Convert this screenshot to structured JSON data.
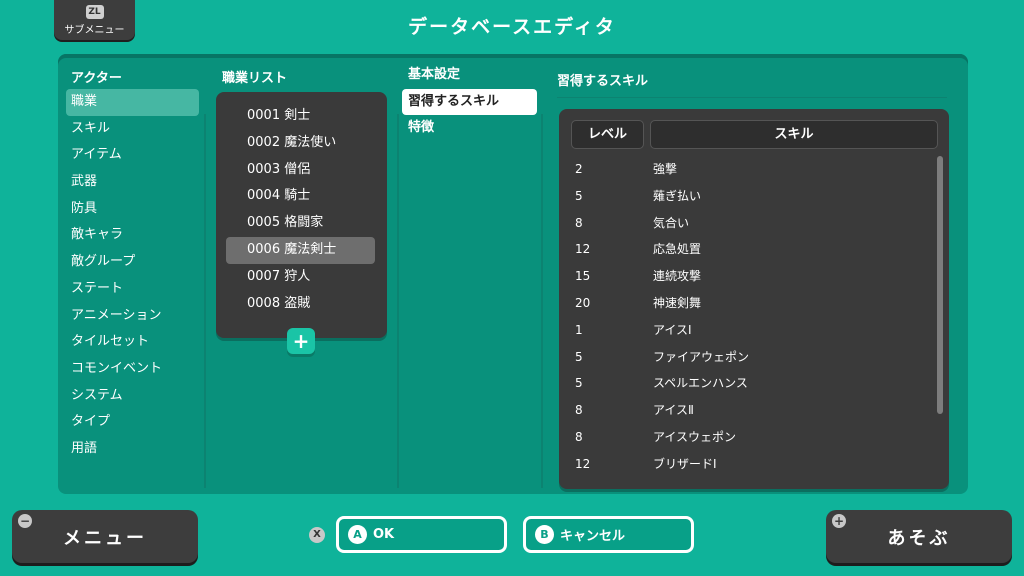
{
  "header": {
    "submenu_badge": "ZL",
    "submenu_label": "サブメニュー",
    "title": "データベースエディタ"
  },
  "categories": {
    "title": "アクター",
    "items": [
      "職業",
      "スキル",
      "アイテム",
      "武器",
      "防具",
      "敵キャラ",
      "敵グループ",
      "ステート",
      "アニメーション",
      "タイルセット",
      "コモンイベント",
      "システム",
      "タイプ",
      "用語"
    ],
    "active_index": 0
  },
  "classes": {
    "title": "職業リスト",
    "items": [
      "0001 剣士",
      "0002 魔法使い",
      "0003 僧侶",
      "0004 騎士",
      "0005 格闘家",
      "0006 魔法剣士",
      "0007 狩人",
      "0008 盗賊"
    ],
    "selected_index": 5,
    "add_label": "+"
  },
  "tabs": {
    "items": [
      "基本設定",
      "習得するスキル",
      "特徴"
    ],
    "active_index": 1
  },
  "skills": {
    "title": "習得するスキル",
    "header_level": "レベル",
    "header_skill": "スキル",
    "rows": [
      {
        "level": "2",
        "name": "強撃"
      },
      {
        "level": "5",
        "name": "薙ぎ払い"
      },
      {
        "level": "8",
        "name": "気合い"
      },
      {
        "level": "12",
        "name": "応急処置"
      },
      {
        "level": "15",
        "name": "連続攻撃"
      },
      {
        "level": "20",
        "name": "神速剣舞"
      },
      {
        "level": "1",
        "name": "アイスⅠ"
      },
      {
        "level": "5",
        "name": "ファイアウェポン"
      },
      {
        "level": "5",
        "name": "スペルエンハンス"
      },
      {
        "level": "8",
        "name": "アイスⅡ"
      },
      {
        "level": "8",
        "name": "アイスウェポン"
      },
      {
        "level": "12",
        "name": "ブリザードⅠ"
      }
    ]
  },
  "footer": {
    "menu_glyph": "−",
    "menu_label": "メニュー",
    "x_glyph": "X",
    "ok_letter": "A",
    "ok_label": "OK",
    "cancel_letter": "B",
    "cancel_label": "キャンセル",
    "play_glyph": "+",
    "play_label": "あそぶ"
  },
  "colors": {
    "background": "#0fb39a",
    "panel": "#09917c",
    "list_box": "#3a3a3a",
    "active_tab": "#ffffff"
  }
}
